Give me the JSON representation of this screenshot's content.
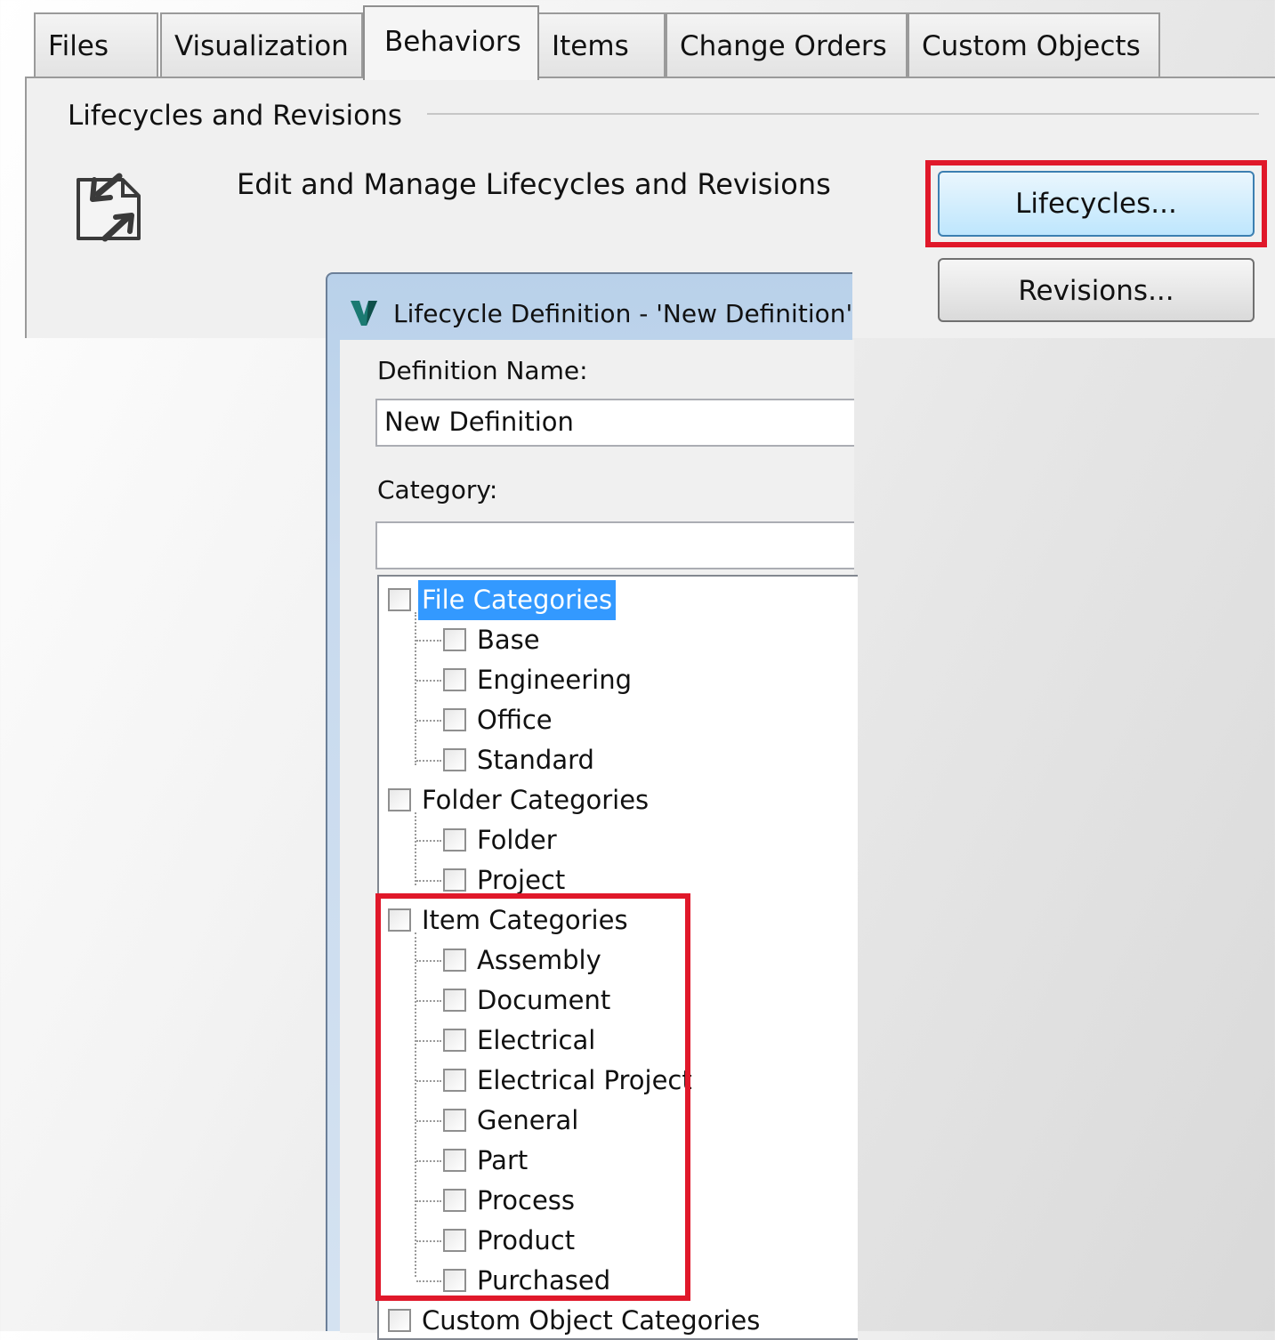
{
  "tabs": [
    {
      "label": "Files"
    },
    {
      "label": "Visualization"
    },
    {
      "label": "Behaviors"
    },
    {
      "label": "Items"
    },
    {
      "label": "Change Orders"
    },
    {
      "label": "Custom Objects"
    }
  ],
  "panel": {
    "group_title": "Lifecycles and Revisions",
    "description": "Edit and Manage Lifecycles and Revisions",
    "lifecycles_button": "Lifecycles...",
    "revisions_button": "Revisions..."
  },
  "dialog": {
    "title": "Lifecycle Definition - 'New Definition'",
    "definition_name_label": "Definition Name:",
    "definition_name_value": "New Definition",
    "category_label": "Category:",
    "category_value": "",
    "tree": [
      {
        "label": "File Categories",
        "children": [
          "Base",
          "Engineering",
          "Office",
          "Standard"
        ]
      },
      {
        "label": "Folder Categories",
        "children": [
          "Folder",
          "Project"
        ]
      },
      {
        "label": "Item Categories",
        "children": [
          "Assembly",
          "Document",
          "Electrical",
          "Electrical Project",
          "General",
          "Part",
          "Process",
          "Product",
          "Purchased"
        ]
      },
      {
        "label": "Custom Object Categories",
        "children": []
      }
    ]
  },
  "colors": {
    "highlight": "#e0182a",
    "selection": "#3399ff",
    "logo": "#1b7a72"
  }
}
